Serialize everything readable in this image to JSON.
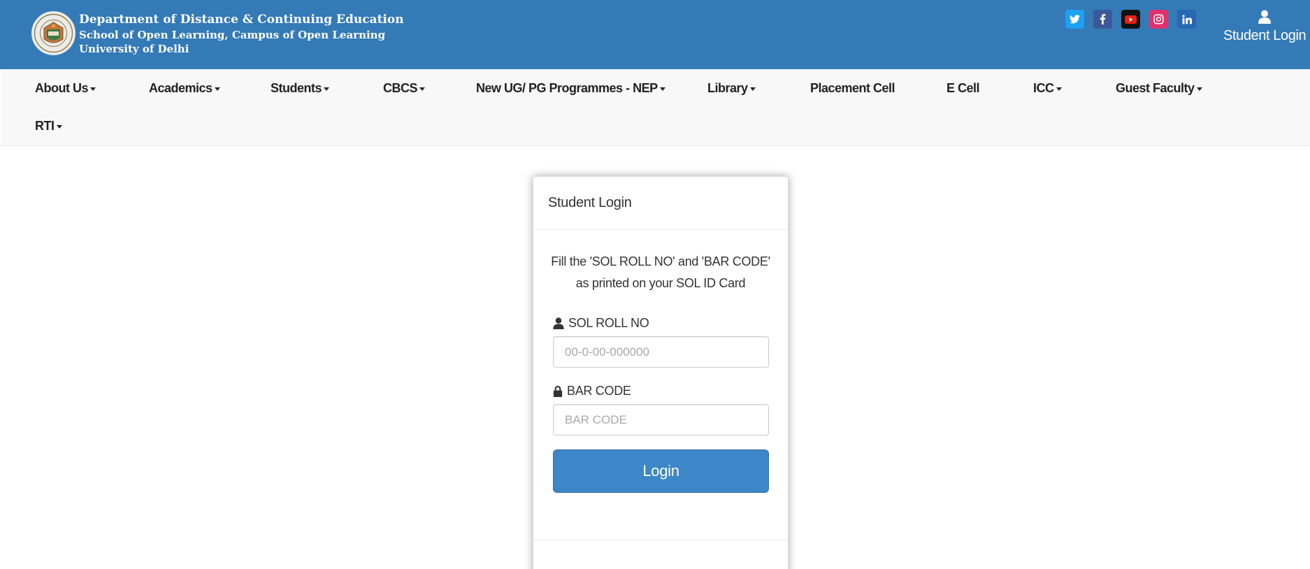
{
  "header": {
    "line1": "Department of Distance & Continuing Education",
    "line2": "School of Open Learning, Campus of Open Learning",
    "line3": "University of Delhi",
    "student_login": "Student Login",
    "socials": [
      {
        "name": "twitter",
        "icon": "twitter-icon",
        "color": "#1da1f2"
      },
      {
        "name": "facebook",
        "icon": "facebook-icon",
        "color": "#3b5998"
      },
      {
        "name": "youtube",
        "icon": "youtube-icon",
        "color": "#111111"
      },
      {
        "name": "instagram",
        "icon": "instagram-icon",
        "color": "#e1306c"
      },
      {
        "name": "linkedin",
        "icon": "linkedin-icon",
        "color": "#2867b2"
      }
    ],
    "brand_color": "#337ab7"
  },
  "nav": {
    "items": [
      {
        "label": "About Us",
        "dropdown": true
      },
      {
        "label": "Academics",
        "dropdown": true
      },
      {
        "label": "Students",
        "dropdown": true
      },
      {
        "label": "CBCS",
        "dropdown": true
      },
      {
        "label": "New UG/ PG Programmes - NEP",
        "dropdown": true
      },
      {
        "label": "Library",
        "dropdown": true
      },
      {
        "label": "Placement Cell",
        "dropdown": false
      },
      {
        "label": "E Cell",
        "dropdown": false
      },
      {
        "label": "ICC",
        "dropdown": true
      },
      {
        "label": "Guest Faculty",
        "dropdown": true
      },
      {
        "label": "RTI",
        "dropdown": true
      }
    ]
  },
  "login": {
    "title": "Student Login",
    "instruction": "Fill the 'SOL ROLL NO' and 'BAR CODE' as printed on your SOL ID Card",
    "roll_label": "SOL ROLL NO",
    "roll_placeholder": "00-0-00-000000",
    "roll_value": "",
    "barcode_label": "BAR CODE",
    "barcode_placeholder": "BAR CODE",
    "barcode_value": "",
    "button_label": "Login",
    "button_color": "#3d87c8"
  }
}
